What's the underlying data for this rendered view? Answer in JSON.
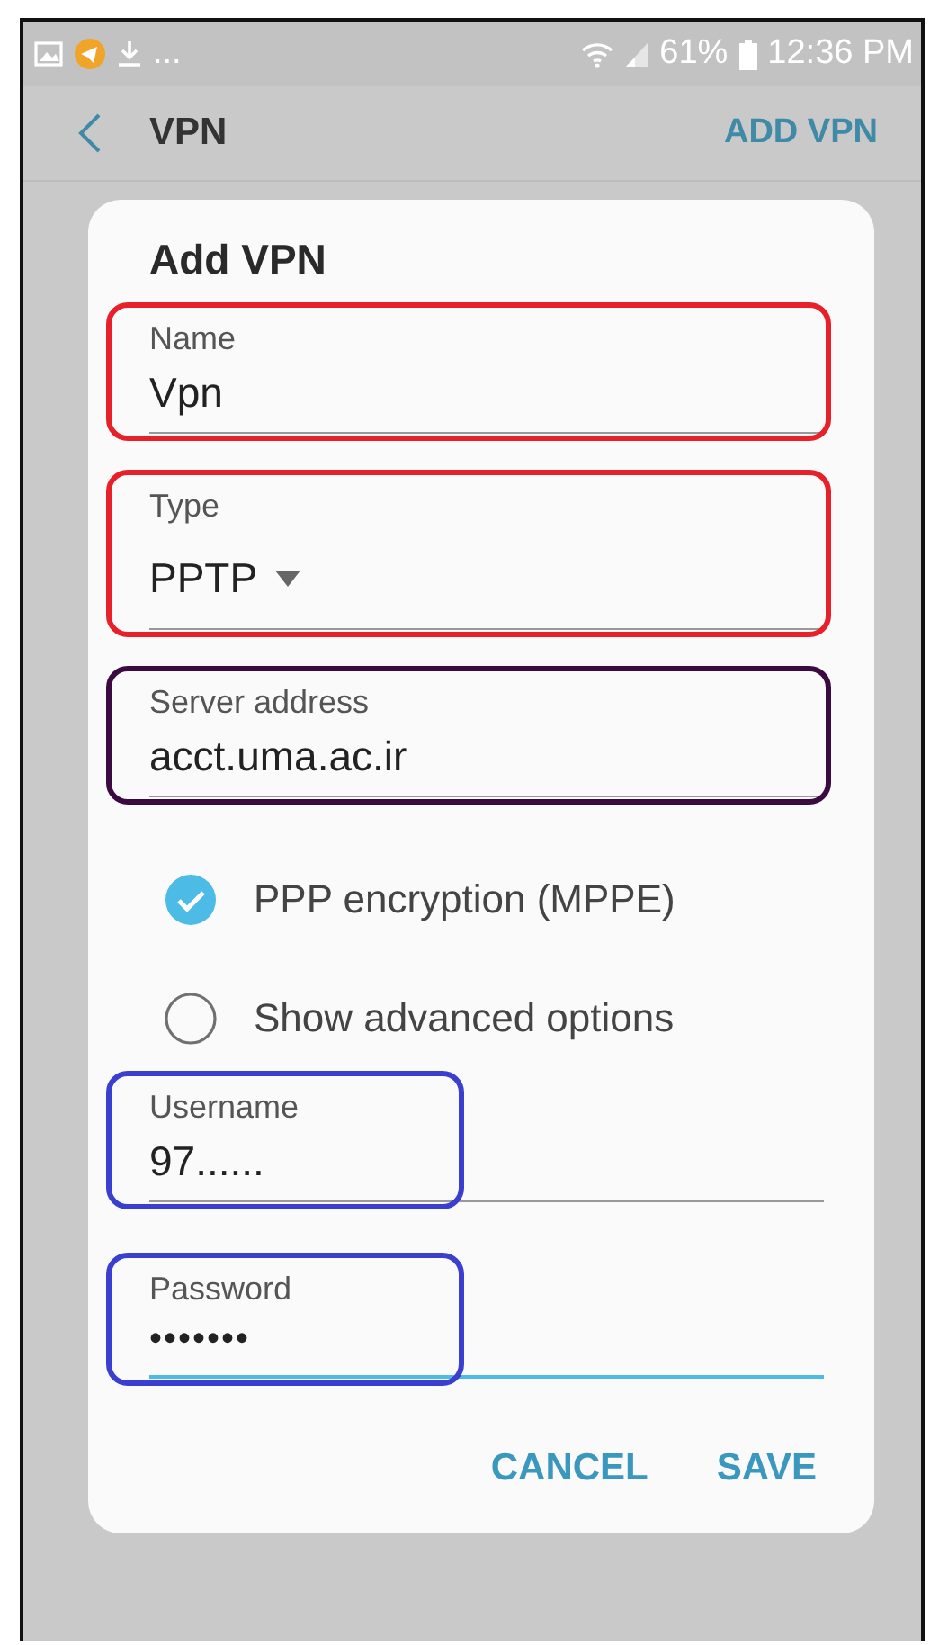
{
  "status_bar": {
    "more": "...",
    "battery": "61%",
    "time": "12:36 PM"
  },
  "app_bar": {
    "title": "VPN",
    "action": "ADD VPN"
  },
  "dialog": {
    "title": "Add VPN",
    "fields": [
      {
        "kind": "text",
        "label": "Name",
        "value": "Vpn",
        "focused": false,
        "color": "#e8202a"
      },
      {
        "kind": "dropdown",
        "label": "Type",
        "value": "PPTP",
        "focused": false,
        "color": "#e8202a"
      },
      {
        "kind": "text",
        "label": "Server address",
        "value": "acct.uma.ac.ir",
        "focused": false,
        "color": "#3a0a40"
      }
    ],
    "options": [
      {
        "label": "PPP encryption (MPPE)",
        "checked": true
      },
      {
        "label": "Show advanced options",
        "checked": false
      }
    ],
    "credentials": [
      {
        "kind": "text",
        "label": "Username",
        "value": "97......",
        "focused": false,
        "color": "#3b3fd0"
      },
      {
        "kind": "password",
        "label": "Password",
        "value": "•••••••",
        "focused": true,
        "color": "#3b3fd0"
      }
    ],
    "buttons": [
      "CANCEL",
      "SAVE"
    ]
  }
}
